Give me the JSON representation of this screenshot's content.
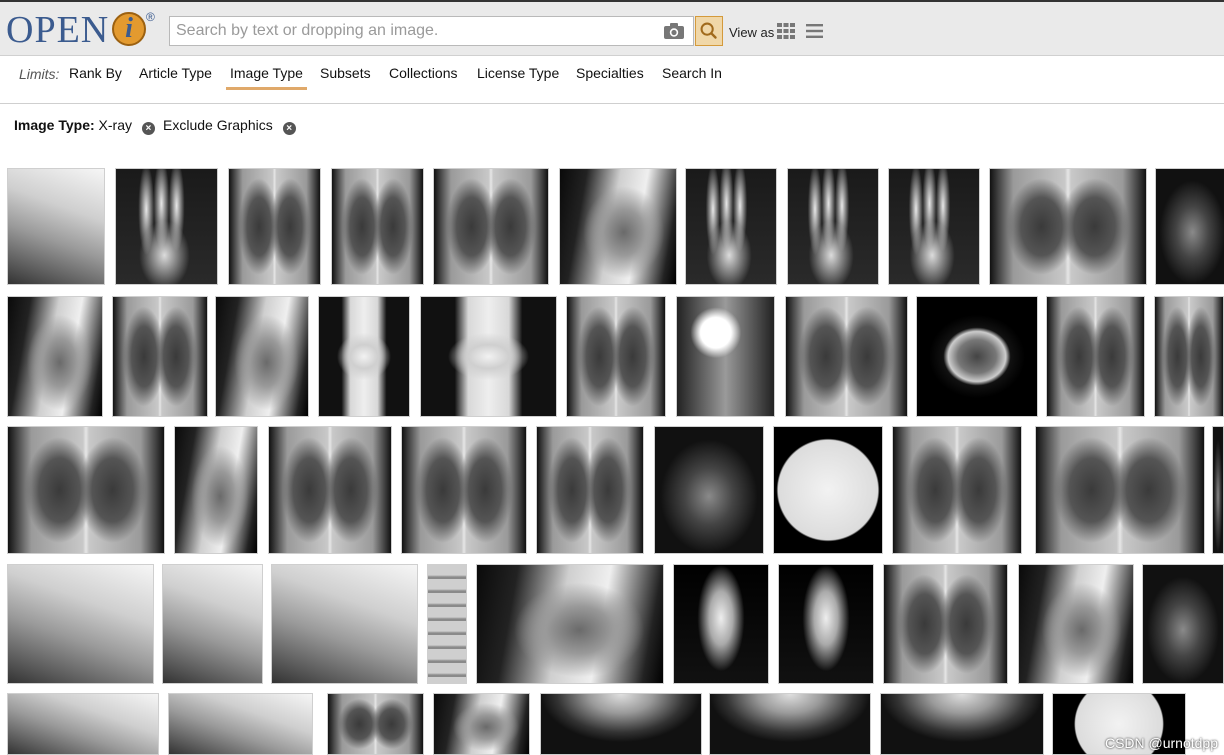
{
  "header": {
    "logo_text": "OPEN",
    "logo_letter": "i",
    "logo_mark": "®",
    "search_placeholder": "Search by text or dropping an image.",
    "view_as_label": "View as",
    "camera_icon": "camera-icon",
    "search_icon": "search-icon",
    "grid_icon": "grid-view-icon",
    "list_icon": "list-view-icon",
    "accent_color": "#d49a3b"
  },
  "limits": {
    "label": "Limits:",
    "tabs": [
      {
        "label": "Rank By"
      },
      {
        "label": "Article Type"
      },
      {
        "label": "Image Type",
        "active": true
      },
      {
        "label": "Subsets"
      },
      {
        "label": "Collections"
      },
      {
        "label": "License Type"
      },
      {
        "label": "Specialties"
      },
      {
        "label": "Search In"
      }
    ]
  },
  "filters": {
    "image_type_label": "Image Type:",
    "image_type_value": "X-ray",
    "exclude_label": "Exclude Graphics"
  },
  "watermark": "CSDN @urnotdpp",
  "results": {
    "rows": [
      [
        {
          "style": "side"
        },
        {
          "style": "hand"
        },
        {
          "style": "chest"
        },
        {
          "style": "chest"
        },
        {
          "style": "chest"
        },
        {
          "style": "lateral"
        },
        {
          "style": "hand"
        },
        {
          "style": "hand"
        },
        {
          "style": "hand"
        },
        {
          "style": "chest"
        },
        {
          "style": "dark"
        }
      ],
      [
        {
          "style": "lateral"
        },
        {
          "style": "chest"
        },
        {
          "style": "lateral"
        },
        {
          "style": "knee"
        },
        {
          "style": "knee"
        },
        {
          "style": "chest"
        },
        {
          "style": "contrast"
        },
        {
          "style": "chest"
        },
        {
          "style": "ct"
        },
        {
          "style": "chest"
        },
        {
          "style": "chest"
        }
      ],
      [
        {
          "style": "chest"
        },
        {
          "style": "lateral"
        },
        {
          "style": "chest"
        },
        {
          "style": "chest"
        },
        {
          "style": "chest"
        },
        {
          "style": "dark"
        },
        {
          "style": "angio"
        },
        {
          "style": "chest"
        },
        {
          "style": "chest"
        },
        {
          "style": "dark"
        }
      ],
      [
        {
          "style": "side"
        },
        {
          "style": "side"
        },
        {
          "style": "side"
        },
        {
          "style": "spine"
        },
        {
          "style": "lateral"
        },
        {
          "style": "foot"
        },
        {
          "style": "foot"
        },
        {
          "style": "chest"
        },
        {
          "style": "lateral"
        },
        {
          "style": "dark"
        }
      ],
      [
        {
          "style": "side"
        },
        {
          "style": "side"
        },
        {
          "style": "chest"
        },
        {
          "style": "lateral"
        },
        {
          "style": "mammo"
        },
        {
          "style": "mammo"
        },
        {
          "style": "mammo"
        },
        {
          "style": "angio"
        }
      ]
    ]
  }
}
